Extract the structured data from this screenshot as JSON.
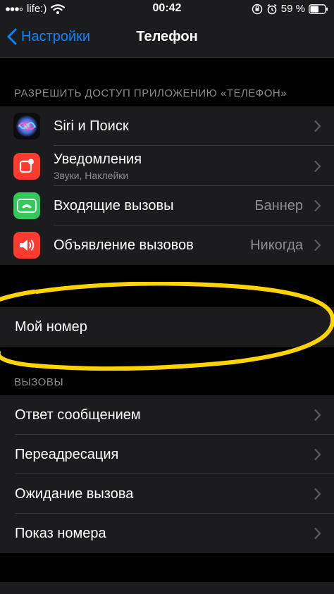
{
  "status_bar": {
    "carrier": "life:)",
    "time": "00:42",
    "battery": "59 %"
  },
  "nav": {
    "back_label": "Настройки",
    "title": "Телефон"
  },
  "section_allow": {
    "header": "РАЗРЕШИТЬ ДОСТУП ПРИЛОЖЕНИЮ «ТЕЛЕФОН»",
    "items": [
      {
        "label": "Siri и Поиск",
        "icon": "siri-icon"
      },
      {
        "label": "Уведомления",
        "sub": "Звуки, Наклейки",
        "icon": "notifications-icon"
      },
      {
        "label": "Входящие вызовы",
        "value": "Баннер",
        "icon": "phone-icon"
      },
      {
        "label": "Объявление вызовов",
        "value": "Никогда",
        "icon": "speaker-icon"
      }
    ]
  },
  "section_number": {
    "items": [
      {
        "label": "Мой номер"
      }
    ]
  },
  "section_calls": {
    "header": "ВЫЗОВЫ",
    "items": [
      {
        "label": "Ответ сообщением"
      },
      {
        "label": "Переадресация"
      },
      {
        "label": "Ожидание вызова"
      },
      {
        "label": "Показ номера"
      }
    ]
  },
  "colors": {
    "accent": "#0a84ff",
    "background": "#000000",
    "cell": "#1c1c1e",
    "highlight_stroke": "#ffd400",
    "notifications": "#ff3b30",
    "phone": "#34c759",
    "speaker": "#ff3b30"
  }
}
